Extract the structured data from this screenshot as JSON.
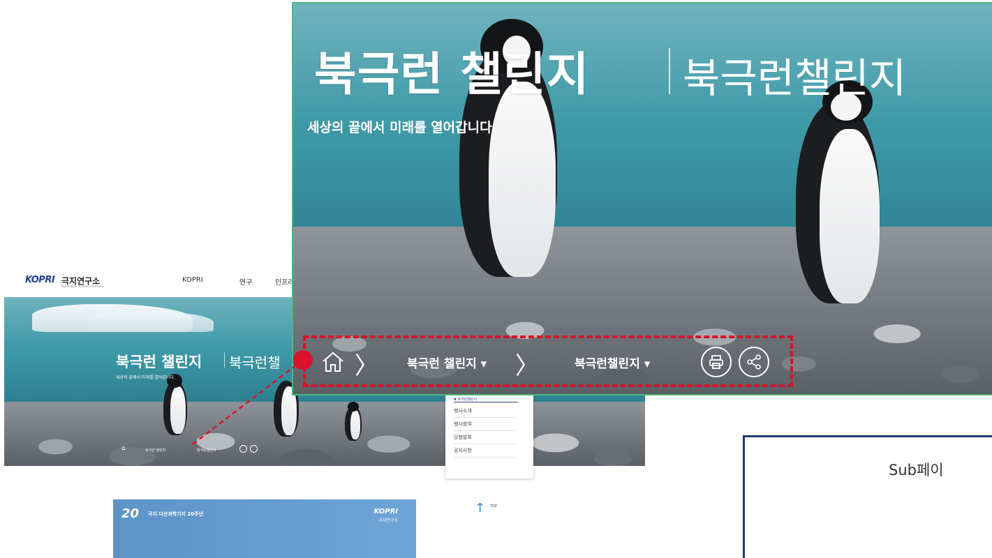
{
  "small_page": {
    "logo_en": "KOPRI",
    "logo_kr": "극지연구소",
    "logo_sub": "Korea Polar Research Institute",
    "nav": [
      "KOPRI",
      "연구",
      "인프라"
    ],
    "hero_title": "북극런 챌린지",
    "hero_title2": "북극런챌",
    "hero_subtitle": "세상의 끝에서 미래를 열어갑니다.",
    "breadcrumb": [
      "북극런 챌린지",
      "북극런챌린지"
    ]
  },
  "dropdown": {
    "header": "▼ 북극런챌린지",
    "items": [
      "행사소개",
      "행사참여",
      "당첨발표",
      "공지사항"
    ]
  },
  "banner": {
    "anniv_num": "20",
    "anniv_text": "극지 다산과학기지 20주년",
    "logo_en": "KOPRI",
    "logo_kr": "극지연구소"
  },
  "top_button": {
    "arrow": "↑",
    "label": "TOP"
  },
  "zoom": {
    "title": "북극런 챌린지",
    "title2": "북극런챌린지",
    "subtitle": "세상의 끝에서 미래를 열어갑니다.",
    "breadcrumb_1": "북극런 챌린지 ▾",
    "breadcrumb_2": "북극런챌린지 ▾",
    "print_icon": "printer-icon",
    "share_icon": "share-icon",
    "home_icon": "home-icon"
  },
  "sub_box": {
    "label": "Sub페이"
  },
  "colors": {
    "highlight_red": "#d8122a",
    "zoom_border": "#4cb87a",
    "sub_border": "#1b3e6c",
    "brand_blue": "#1f3f8f"
  }
}
